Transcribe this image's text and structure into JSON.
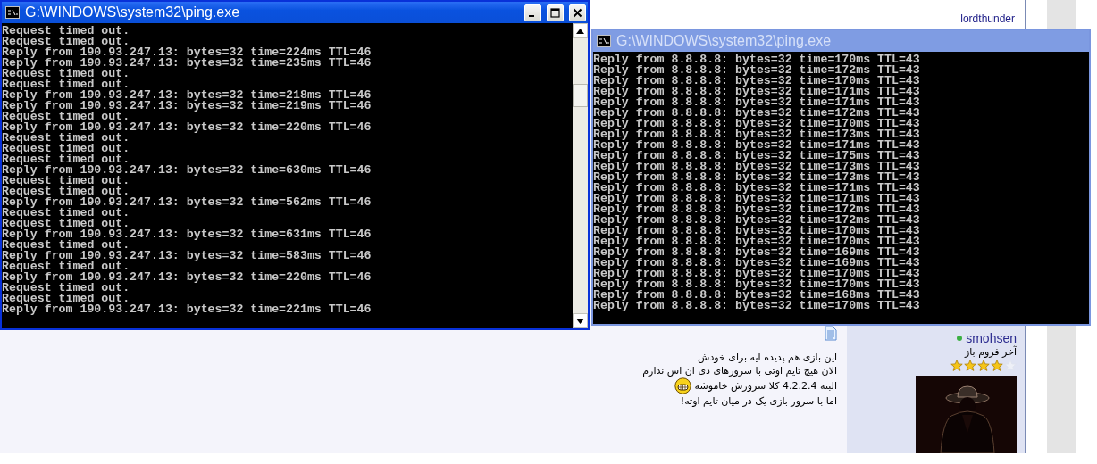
{
  "forum": {
    "top_username": "lordthunder",
    "post": {
      "lines": [
        {
          "text": "این بازی هم پدیده ایه برای خودش",
          "emoticon": false
        },
        {
          "text": "الان هیچ تایم اوتی با سرورهای دی ان اس ندارم",
          "emoticon": false
        },
        {
          "text": "البته 4.2.2.4 کلا سرورش خاموشه",
          "emoticon": true
        },
        {
          "text": "اما با سرور بازی یک در میان تایم اوته!",
          "emoticon": false
        }
      ]
    },
    "user": {
      "name": "smohsen",
      "online": true,
      "title": "آخر فروم باز",
      "stars": 4
    }
  },
  "windows": [
    {
      "title": "G:\\WINDOWS\\system32\\ping.exe",
      "active": true,
      "lines": [
        "Request timed out.",
        "Request timed out.",
        "Reply from 190.93.247.13: bytes=32 time=224ms TTL=46",
        "Reply from 190.93.247.13: bytes=32 time=235ms TTL=46",
        "Request timed out.",
        "Request timed out.",
        "Reply from 190.93.247.13: bytes=32 time=218ms TTL=46",
        "Reply from 190.93.247.13: bytes=32 time=219ms TTL=46",
        "Request timed out.",
        "Reply from 190.93.247.13: bytes=32 time=220ms TTL=46",
        "Request timed out.",
        "Request timed out.",
        "Request timed out.",
        "Reply from 190.93.247.13: bytes=32 time=630ms TTL=46",
        "Request timed out.",
        "Request timed out.",
        "Reply from 190.93.247.13: bytes=32 time=562ms TTL=46",
        "Request timed out.",
        "Request timed out.",
        "Reply from 190.93.247.13: bytes=32 time=631ms TTL=46",
        "Request timed out.",
        "Reply from 190.93.247.13: bytes=32 time=583ms TTL=46",
        "Request timed out.",
        "Reply from 190.93.247.13: bytes=32 time=220ms TTL=46",
        "Request timed out.",
        "Request timed out.",
        "Reply from 190.93.247.13: bytes=32 time=221ms TTL=46"
      ]
    },
    {
      "title": "G:\\WINDOWS\\system32\\ping.exe",
      "active": false,
      "lines": [
        "Reply from 8.8.8.8: bytes=32 time=170ms TTL=43",
        "Reply from 8.8.8.8: bytes=32 time=172ms TTL=43",
        "Reply from 8.8.8.8: bytes=32 time=170ms TTL=43",
        "Reply from 8.8.8.8: bytes=32 time=171ms TTL=43",
        "Reply from 8.8.8.8: bytes=32 time=171ms TTL=43",
        "Reply from 8.8.8.8: bytes=32 time=172ms TTL=43",
        "Reply from 8.8.8.8: bytes=32 time=170ms TTL=43",
        "Reply from 8.8.8.8: bytes=32 time=173ms TTL=43",
        "Reply from 8.8.8.8: bytes=32 time=171ms TTL=43",
        "Reply from 8.8.8.8: bytes=32 time=175ms TTL=43",
        "Reply from 8.8.8.8: bytes=32 time=173ms TTL=43",
        "Reply from 8.8.8.8: bytes=32 time=173ms TTL=43",
        "Reply from 8.8.8.8: bytes=32 time=171ms TTL=43",
        "Reply from 8.8.8.8: bytes=32 time=171ms TTL=43",
        "Reply from 8.8.8.8: bytes=32 time=172ms TTL=43",
        "Reply from 8.8.8.8: bytes=32 time=172ms TTL=43",
        "Reply from 8.8.8.8: bytes=32 time=170ms TTL=43",
        "Reply from 8.8.8.8: bytes=32 time=170ms TTL=43",
        "Reply from 8.8.8.8: bytes=32 time=169ms TTL=43",
        "Reply from 8.8.8.8: bytes=32 time=169ms TTL=43",
        "Reply from 8.8.8.8: bytes=32 time=170ms TTL=43",
        "Reply from 8.8.8.8: bytes=32 time=170ms TTL=43",
        "Reply from 8.8.8.8: bytes=32 time=168ms TTL=43",
        "Reply from 8.8.8.8: bytes=32 time=170ms TTL=43"
      ]
    }
  ]
}
